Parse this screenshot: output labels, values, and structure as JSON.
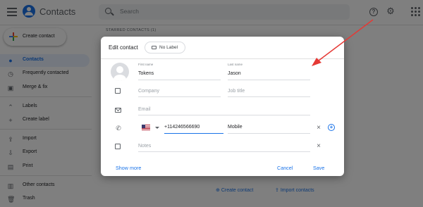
{
  "app": {
    "title": "Contacts",
    "brand_color": "#1a73e8"
  },
  "header": {
    "search_placeholder": "Search",
    "icons": [
      "menu-icon",
      "contacts-logo-icon",
      "search-icon",
      "help-icon",
      "gear-icon",
      "apps-icon"
    ]
  },
  "sidebar": {
    "create_label": "Create contact",
    "items": [
      {
        "label": "Contacts",
        "icon": "person-icon",
        "active": true
      },
      {
        "label": "Frequently contacted",
        "icon": "history-icon"
      },
      {
        "label": "Merge & fix",
        "icon": "merge-icon"
      },
      {
        "label": "Labels",
        "icon": "chevron-up-icon"
      },
      {
        "label": "Create label",
        "icon": "plus-icon"
      },
      {
        "label": "Import",
        "icon": "upload-icon"
      },
      {
        "label": "Export",
        "icon": "download-icon"
      },
      {
        "label": "Print",
        "icon": "print-icon"
      },
      {
        "label": "Other contacts",
        "icon": "other-contacts-icon"
      },
      {
        "label": "Trash",
        "icon": "trash-icon"
      }
    ]
  },
  "main": {
    "starred_label": "STARRED CONTACTS (1)",
    "bottom_links": {
      "create": "Create contact",
      "import": "Import contacts"
    }
  },
  "dialog": {
    "title": "Edit contact",
    "label_chip": "No Label",
    "first_name_label": "First name",
    "first_name_value": "Tokens",
    "last_name_label": "Last name",
    "last_name_value": "Jason",
    "company_placeholder": "Company",
    "job_title_placeholder": "Job title",
    "email_placeholder": "Email",
    "phone_value": "+114246566690",
    "phone_type": "Mobile",
    "notes_placeholder": "Notes",
    "show_more": "Show more",
    "cancel": "Cancel",
    "save": "Save"
  },
  "annotation": {
    "arrow_color": "#e53935"
  }
}
